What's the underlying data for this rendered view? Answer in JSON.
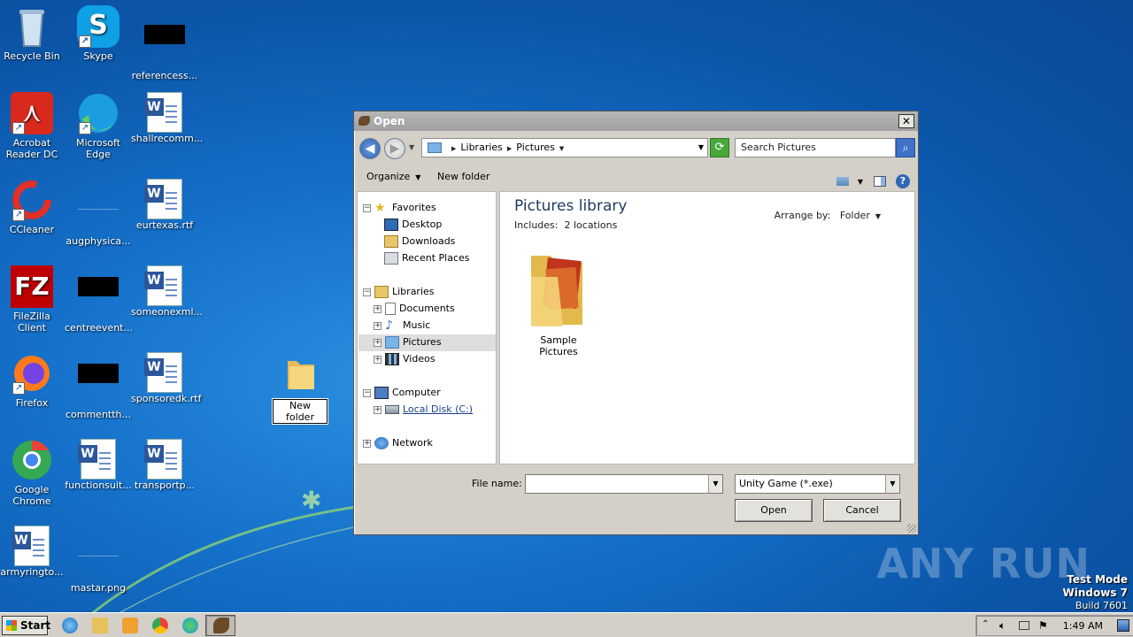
{
  "desktop": {
    "icons": {
      "recycle_bin": "Recycle Bin",
      "skype": "Skype",
      "referencess": "referencess...",
      "acrobat": "Acrobat Reader DC",
      "edge": "Microsoft Edge",
      "shallrecomm": "shallrecomm...",
      "ccleaner": "CCleaner",
      "augphysica": "augphysica...",
      "eurtexas": "eurtexas.rtf",
      "filezilla": "FileZilla Client",
      "centreevent": "centreevent...",
      "someonexml": "someonexml...",
      "firefox": "Firefox",
      "commentth": "commentth...",
      "sponsoredk": "sponsoredk.rtf",
      "chrome": "Google Chrome",
      "functionsuit": "functionsuit...",
      "transportp": "transportp...",
      "armyringto": "armyringto...",
      "mastar": "mastar.png",
      "new_folder": "New folder"
    },
    "watermark": "ANY RUN",
    "os_info": {
      "line1": "Test Mode",
      "line2": "Windows 7",
      "line3": "Build 7601"
    }
  },
  "dialog": {
    "title": "Open",
    "close": "✕",
    "breadcrumb": [
      "Libraries",
      "Pictures"
    ],
    "search_placeholder": "Search Pictures",
    "toolbar": {
      "organize": "Organize",
      "new_folder": "New folder"
    },
    "nav": {
      "favorites": "Favorites",
      "desktop": "Desktop",
      "downloads": "Downloads",
      "recent": "Recent Places",
      "libraries": "Libraries",
      "documents": "Documents",
      "music": "Music",
      "pictures": "Pictures",
      "videos": "Videos",
      "computer": "Computer",
      "local_disk": "Local Disk (C:)",
      "network": "Network"
    },
    "content": {
      "title": "Pictures library",
      "includes_label": "Includes:",
      "includes_value": "2 locations",
      "arrange_label": "Arrange by:",
      "arrange_value": "Folder",
      "items": [
        "Sample Pictures"
      ]
    },
    "file_name_label": "File name:",
    "file_name_value": "",
    "file_type": "Unity Game (*.exe)",
    "open_button": "Open",
    "cancel_button": "Cancel"
  },
  "taskbar": {
    "start": "Start",
    "clock": "1:49 AM"
  }
}
